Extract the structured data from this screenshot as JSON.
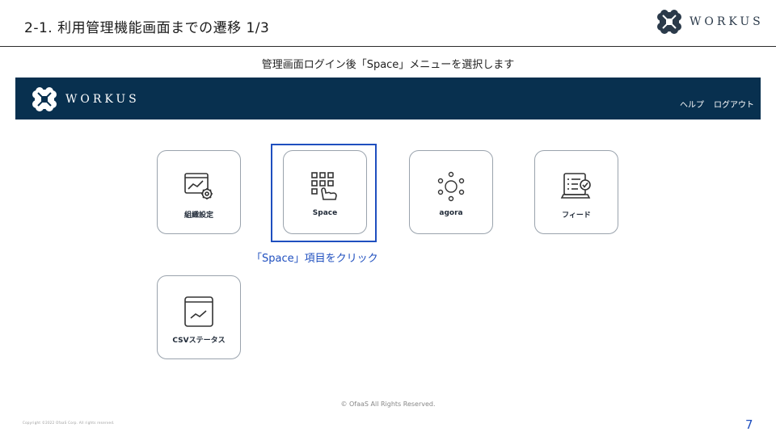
{
  "slide": {
    "title": "2-1.  利用管理機能画面までの遷移 1/3",
    "brand": "WORKUS",
    "caption": "管理画面ログイン後「Space」メニューを選択します",
    "page_number": "7",
    "small_copyright": "Copyright ©2022 OfaaS Corp. All rights reserved."
  },
  "app": {
    "brand": "WORKUS",
    "nav": {
      "help": "ヘルプ",
      "logout": "ログアウト"
    },
    "tiles": [
      {
        "label": "組織設定",
        "icon": "settings-window-icon"
      },
      {
        "label": "Space",
        "icon": "grid-hand-icon"
      },
      {
        "label": "agora",
        "icon": "sun-icon"
      },
      {
        "label": "フィード",
        "icon": "checklist-monitor-icon"
      },
      {
        "label": "CSVステータス",
        "icon": "chart-monitor-icon"
      }
    ],
    "footer": "© OfaaS All Rights Reserved."
  },
  "annotation": {
    "hint": "「Space」項目をクリック"
  },
  "colors": {
    "appbar": "#08304f",
    "accent": "#1f4fbf",
    "logo": "#2b3a4a"
  }
}
